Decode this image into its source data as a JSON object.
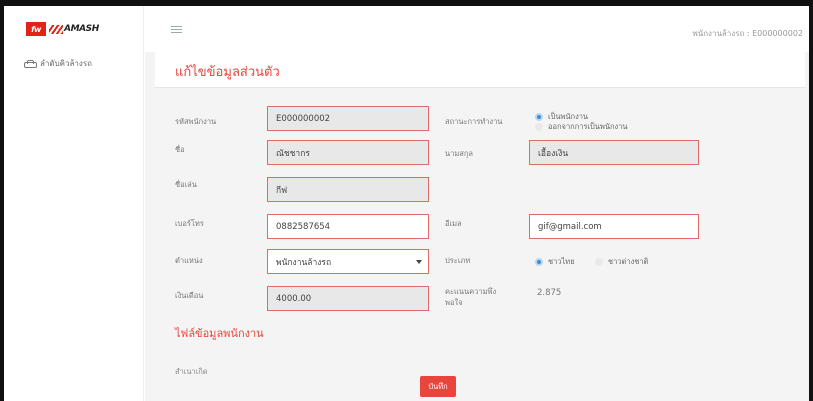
{
  "brand": {
    "badge": "fw",
    "name": "AMASH"
  },
  "sidebar": {
    "items": [
      {
        "label": "ลำดับคิวล้างรถ",
        "icon": "car-icon"
      }
    ]
  },
  "header": {
    "user_text": "พนักงานล้างรถ : E000000002"
  },
  "page": {
    "title": "แก้ไขข้อมูลส่วนตัว"
  },
  "form": {
    "employee_id": {
      "label": "รหัสพนักงาน",
      "value": "E000000002"
    },
    "work_status": {
      "label": "สถานะการทำงาน",
      "options": [
        "เป็นพนักงาน",
        "ออกจากการเป็นพนักงาน"
      ],
      "selected": "เป็นพนักงาน"
    },
    "first_name": {
      "label": "ชื่อ",
      "value": "ณัชชากร"
    },
    "last_name": {
      "label": "นามสกุล",
      "value": "เอื้องเงิน"
    },
    "nickname": {
      "label": "ชื่อเล่น",
      "value": "กีฟ"
    },
    "phone": {
      "label": "เบอร์โทร",
      "value": "0882587654"
    },
    "email": {
      "label": "อีเมล",
      "value": "gif@gmail.com"
    },
    "position": {
      "label": "ตำแหน่ง",
      "value": "พนักงานล้างรถ"
    },
    "nationality": {
      "label": "ประเภท",
      "options": [
        "ชาวไทย",
        "ชาวต่างชาติ"
      ],
      "selected": "ชาวไทย"
    },
    "salary": {
      "label": "เงินเดือน",
      "value": "4000.00"
    },
    "satisfaction": {
      "label": "คะแนนความพึงพอใจ",
      "value": "2.875"
    }
  },
  "file_section": {
    "title": "ไฟล์ข้อมูลพนักงาน",
    "birthplace_label": "สำเนาเกิด"
  },
  "actions": {
    "save_label": "บันทึก"
  },
  "colors": {
    "accent": "#e8453c",
    "radio_on": "#3b8fd6",
    "field_border": "#e06a6a"
  }
}
